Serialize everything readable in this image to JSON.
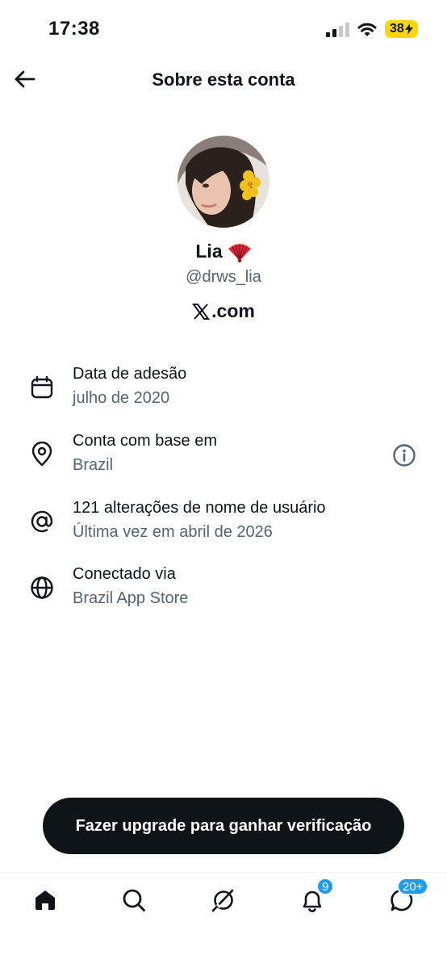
{
  "status_bar": {
    "time": "17:38",
    "battery": "38",
    "battery_color": "#ffd60a"
  },
  "header": {
    "title": "Sobre esta conta",
    "back_icon": "arrow-left-icon"
  },
  "profile": {
    "name": "Lia",
    "name_emoji_icon": "folding-fan-icon",
    "handle": "@drws_lia",
    "site": ".com",
    "site_logo_icon": "x-logo-icon"
  },
  "info": [
    {
      "icon": "calendar-icon",
      "title": "Data de adesão",
      "subtitle": "julho de 2020"
    },
    {
      "icon": "location-pin-icon",
      "title": "Conta com base em",
      "subtitle": "Brazil",
      "action_icon": "info-icon"
    },
    {
      "icon": "at-sign-icon",
      "title": "121 alterações de nome de usuário",
      "subtitle": "Última vez em abril de 2026"
    },
    {
      "icon": "globe-icon",
      "title": "Conectado via",
      "subtitle": "Brazil App Store"
    }
  ],
  "upgrade_button": {
    "label": "Fazer upgrade para ganhar verificação"
  },
  "bottom_nav": {
    "items": [
      {
        "icon": "home-icon"
      },
      {
        "icon": "search-icon"
      },
      {
        "icon": "grok-icon"
      },
      {
        "icon": "notifications-bell-icon",
        "badge": "9"
      },
      {
        "icon": "messages-icon",
        "badge": "20+"
      }
    ],
    "accent": "#1d9bf0"
  },
  "colors": {
    "text_primary": "#0f1419",
    "text_secondary": "#536471",
    "button_bg": "#0f1419"
  }
}
